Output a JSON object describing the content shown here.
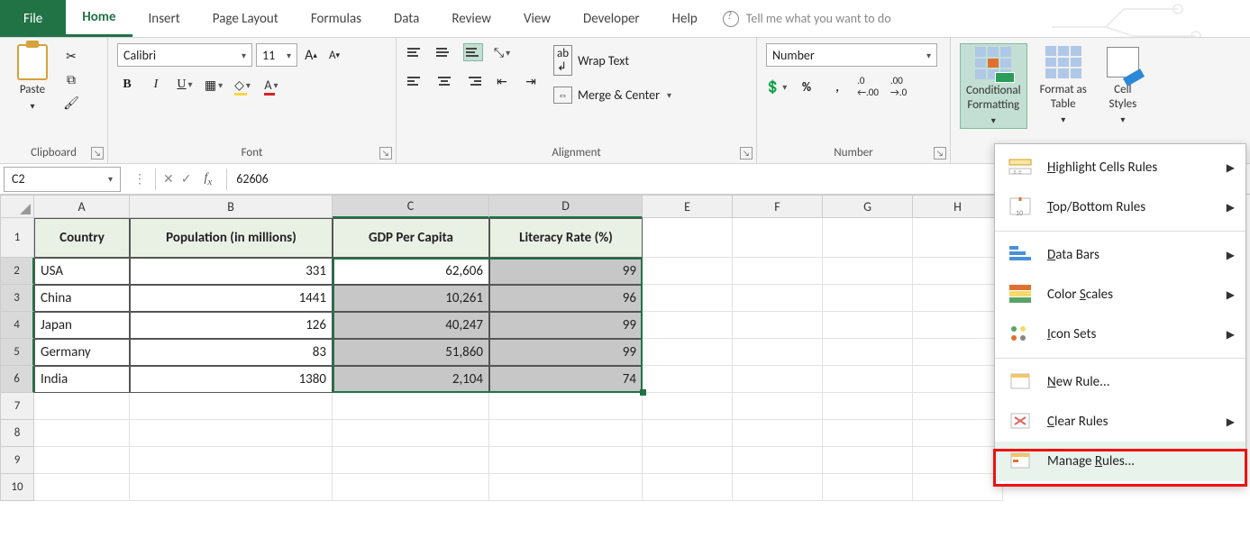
{
  "tabs": {
    "file": "File",
    "home": "Home",
    "insert": "Insert",
    "page_layout": "Page Layout",
    "formulas": "Formulas",
    "data": "Data",
    "review": "Review",
    "view": "View",
    "developer": "Developer",
    "help": "Help",
    "tell_me": "Tell me what you want to do"
  },
  "ribbon": {
    "clipboard": {
      "paste": "Paste",
      "label": "Clipboard"
    },
    "font": {
      "name": "Calibri",
      "size": "11",
      "label": "Font"
    },
    "alignment": {
      "wrap": "Wrap Text",
      "merge": "Merge & Center",
      "label": "Alignment"
    },
    "number": {
      "format": "Number",
      "label": "Number"
    },
    "styles": {
      "cond": "Conditional\nFormatting",
      "fat": "Format as\nTable",
      "cell": "Cell\nStyles"
    }
  },
  "namebox": "C2",
  "formula_value": "62606",
  "columns": [
    "A",
    "B",
    "C",
    "D",
    "E",
    "F",
    "G",
    "H"
  ],
  "headers": {
    "A": "Country",
    "B": "Population (in millions)",
    "C": "GDP Per Capita",
    "D": "Literacy Rate (%)"
  },
  "rows": [
    {
      "A": "USA",
      "B": "331",
      "C": "62,606",
      "D": "99"
    },
    {
      "A": "China",
      "B": "1441",
      "C": "10,261",
      "D": "96"
    },
    {
      "A": "Japan",
      "B": "126",
      "C": "40,247",
      "D": "99"
    },
    {
      "A": "Germany",
      "B": "83",
      "C": "51,860",
      "D": "99"
    },
    {
      "A": "India",
      "B": "1380",
      "C": "2,104",
      "D": "74"
    }
  ],
  "cf_menu": {
    "highlight": "Highlight Cells Rules",
    "topbottom": "Top/Bottom Rules",
    "databars": "Data Bars",
    "colorscales": "Color Scales",
    "iconsets": "Icon Sets",
    "newrule": "New Rule...",
    "clear": "Clear Rules",
    "manage": "Manage Rules..."
  },
  "chart_data": {
    "type": "table",
    "title": "Country Statistics",
    "columns": [
      "Country",
      "Population (in millions)",
      "GDP Per Capita",
      "Literacy Rate (%)"
    ],
    "rows": [
      [
        "USA",
        331,
        62606,
        99
      ],
      [
        "China",
        1441,
        10261,
        96
      ],
      [
        "Japan",
        126,
        40247,
        99
      ],
      [
        "Germany",
        83,
        51860,
        99
      ],
      [
        "India",
        1380,
        2104,
        74
      ]
    ]
  }
}
